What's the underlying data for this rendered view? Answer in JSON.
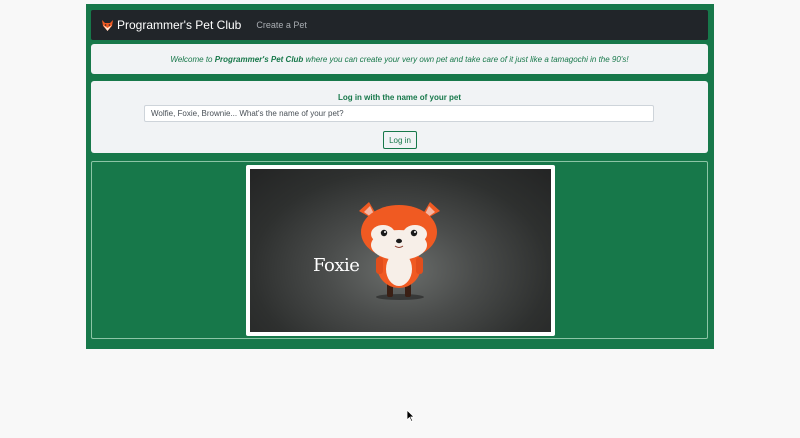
{
  "navbar": {
    "brand_label": "Programmer's Pet Club",
    "brand_icon": "fox-icon",
    "create_link": "Create a Pet"
  },
  "welcome": {
    "prefix": "Welcome to ",
    "club_name": "Programmer's Pet Club",
    "suffix": " where you can create your very own pet and take care of it just like a tamagochi in the 90's!"
  },
  "login": {
    "title": "Log in with the name of your pet",
    "placeholder": "Wolfie, Foxie, Brownie... What's the name of your pet?",
    "button_label": "Log in"
  },
  "pet_card": {
    "name": "Foxie",
    "image_subject": "fox-character"
  },
  "colors": {
    "brand_green": "#17784a",
    "navbar_bg": "#212529",
    "panel_bg": "#f1f3f5",
    "fox_orange": "#f05a22"
  }
}
